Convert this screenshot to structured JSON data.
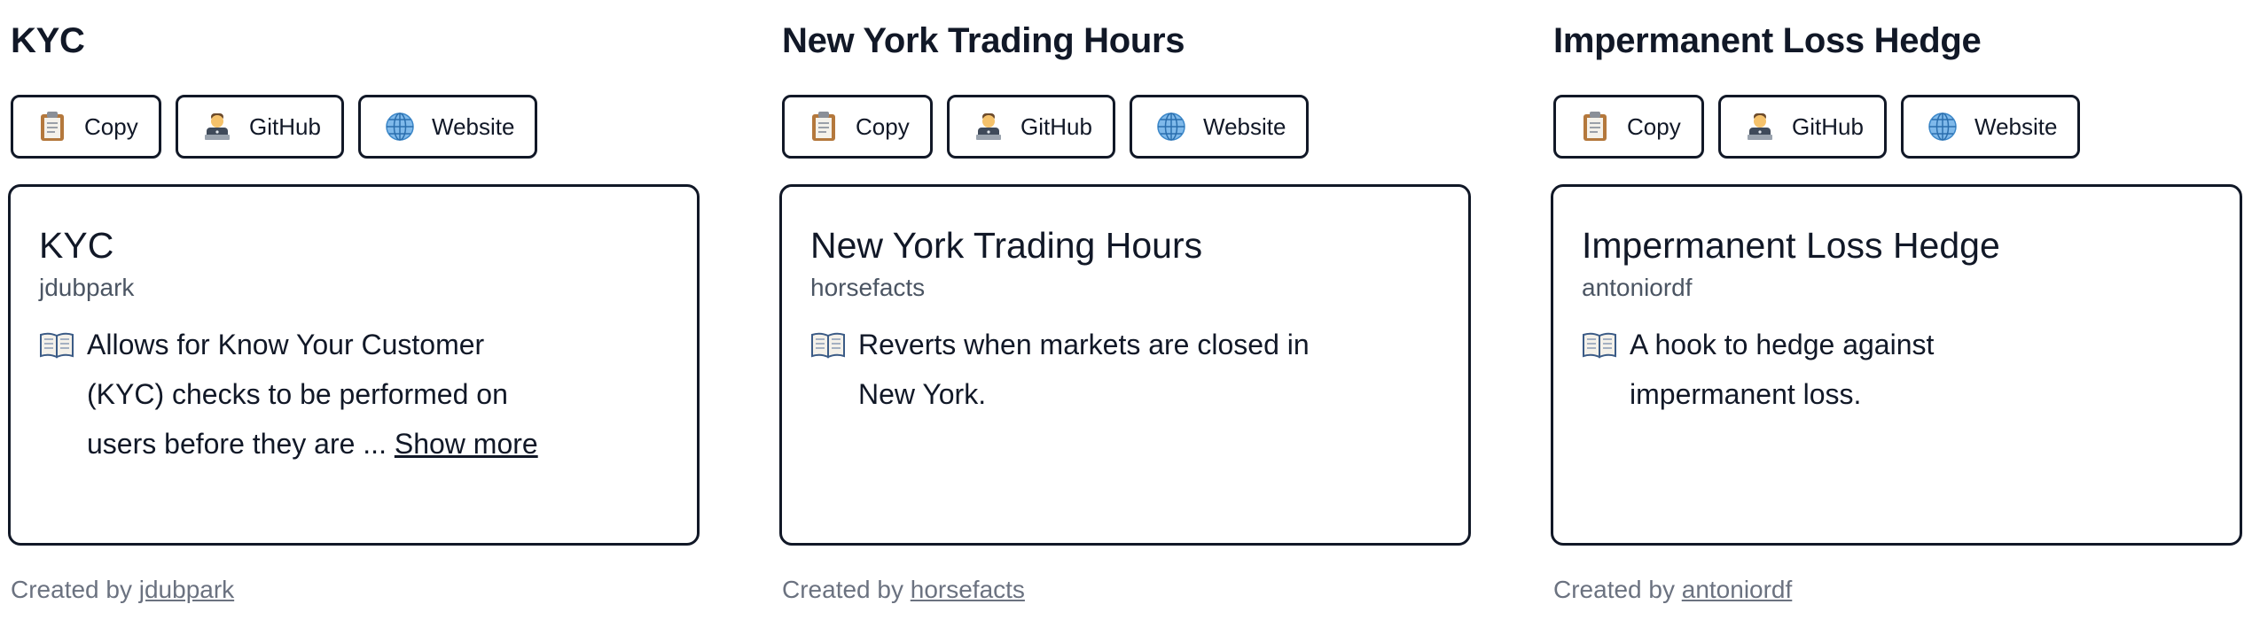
{
  "hooks": [
    {
      "title": "KYC",
      "buttons": {
        "copy": "Copy",
        "github": "GitHub",
        "website": "Website"
      },
      "card": {
        "title": "KYC",
        "author": "jdubpark",
        "description_lines": [
          "Allows for Know Your Customer",
          "(KYC) checks to be performed on",
          "users before they are ... "
        ],
        "show_more": "Show more"
      },
      "footer": {
        "prefix": "Created by ",
        "author": "jdubpark"
      }
    },
    {
      "title": "New York Trading Hours",
      "buttons": {
        "copy": "Copy",
        "github": "GitHub",
        "website": "Website"
      },
      "card": {
        "title": "New York Trading Hours",
        "author": "horsefacts",
        "description_lines": [
          "Reverts when markets are closed in",
          "New York."
        ]
      },
      "footer": {
        "prefix": "Created by ",
        "author": "horsefacts"
      }
    },
    {
      "title": "Impermanent Loss Hedge",
      "buttons": {
        "copy": "Copy",
        "github": "GitHub",
        "website": "Website"
      },
      "card": {
        "title": "Impermanent Loss Hedge",
        "author": "antoniordf",
        "description_lines": [
          "A hook to hedge against",
          "impermanent loss."
        ]
      },
      "footer": {
        "prefix": "Created by ",
        "author": "antoniordf"
      }
    }
  ],
  "icons": {
    "copy": "clipboard-icon",
    "github": "technologist-icon",
    "website": "globe-icon",
    "description": "open-book-icon"
  },
  "colors": {
    "text": "#111827",
    "muted": "#4b5563",
    "footer": "#6b7280",
    "border": "#111827"
  }
}
